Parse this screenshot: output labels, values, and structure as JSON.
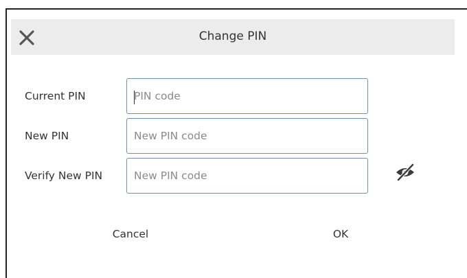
{
  "dialog": {
    "title": "Change PIN",
    "close_icon": "close-icon"
  },
  "form": {
    "current_pin": {
      "label": "Current PIN",
      "placeholder": "PIN code",
      "value": ""
    },
    "new_pin": {
      "label": "New PIN",
      "placeholder": "New PIN code",
      "value": ""
    },
    "verify_pin": {
      "label": "Verify New PIN",
      "placeholder": "New PIN code",
      "value": ""
    },
    "visibility_icon": "eye-slash-icon"
  },
  "buttons": {
    "cancel_label": "Cancel",
    "ok_label": "OK"
  }
}
